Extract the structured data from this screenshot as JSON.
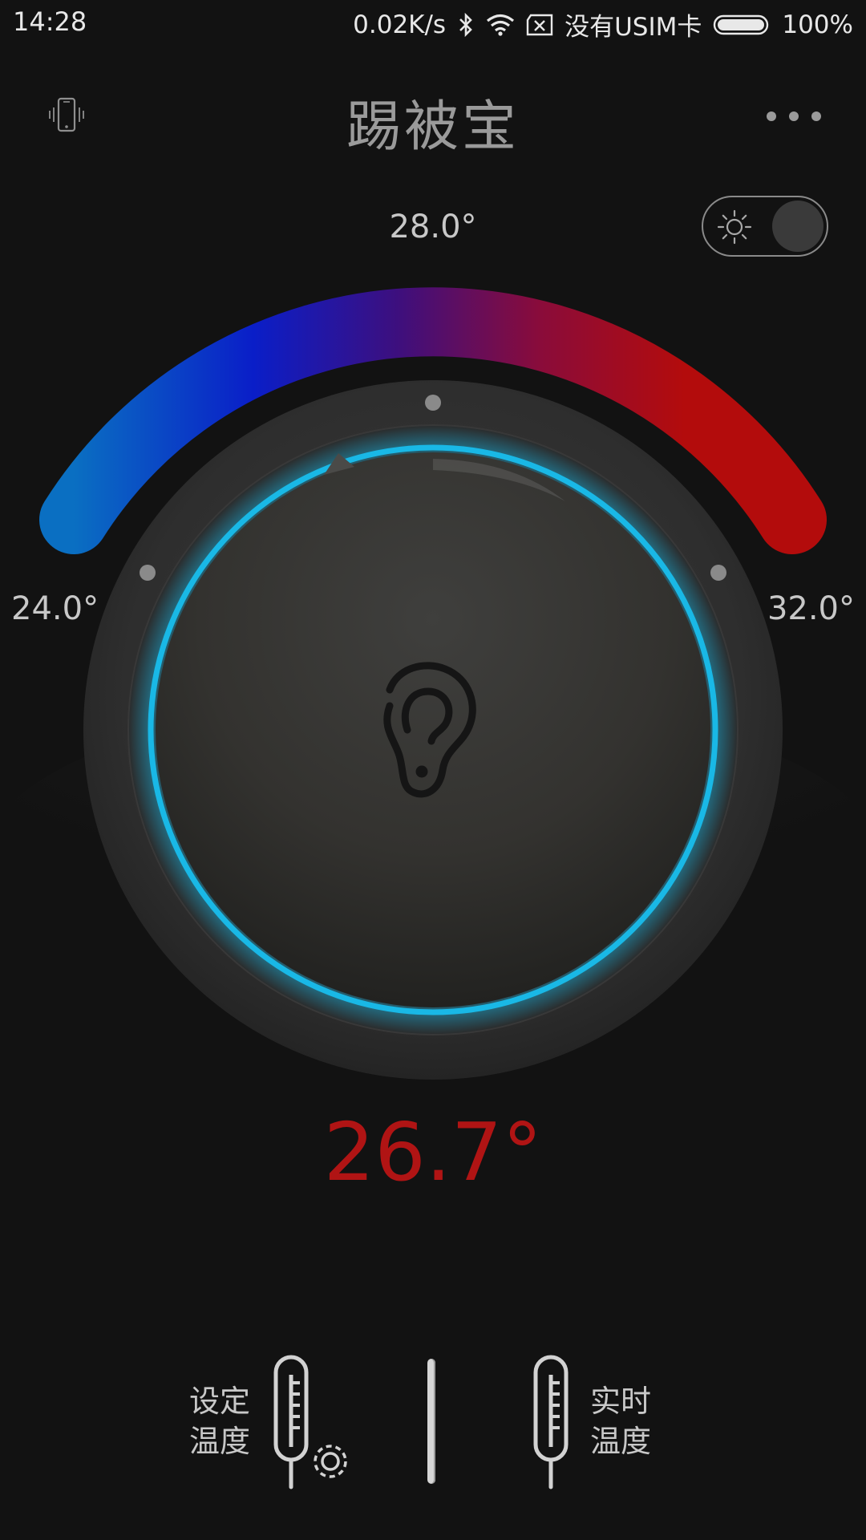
{
  "status_bar": {
    "time": "14:28",
    "net_speed": "0.02K/s",
    "sim_status": "没有USIM卡",
    "battery": "100%"
  },
  "header": {
    "title": "踢被宝"
  },
  "dial": {
    "min_label": "24.0°",
    "max_label": "32.0°",
    "mid_label": "28.0°",
    "min_value": 24.0,
    "max_value": 32.0,
    "set_value": 26.2,
    "gradient_colors": [
      "#0a6fc2",
      "#0a1ec8",
      "#3d0f7e",
      "#8a0c3a",
      "#b30c0c"
    ],
    "ring_accent": "#19b8e6"
  },
  "current_temperature": "26.7°",
  "bottom": {
    "set_temp_line1": "设定",
    "set_temp_line2": "温度",
    "real_temp_line1": "实时",
    "real_temp_line2": "温度"
  },
  "colors": {
    "background": "#121212",
    "current_temp": "#b01414"
  }
}
